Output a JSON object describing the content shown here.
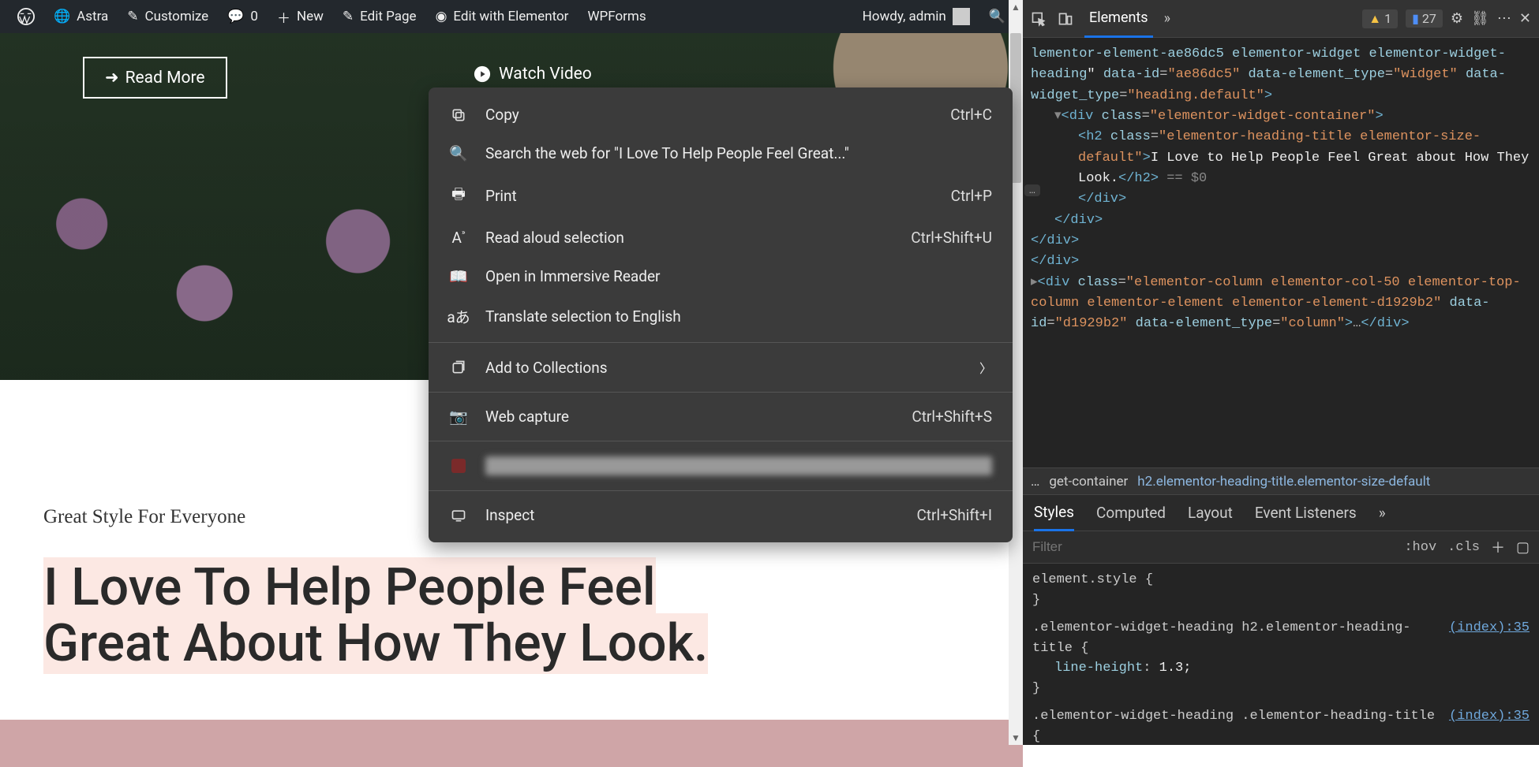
{
  "admin_bar": {
    "site_name": "Astra",
    "customize": "Customize",
    "comments_count": "0",
    "new": "New",
    "edit_page": "Edit Page",
    "edit_elementor": "Edit with Elementor",
    "wpforms": "WPForms",
    "howdy": "Howdy, admin"
  },
  "hero": {
    "read_more": "Read More",
    "watch_video": "Watch Video"
  },
  "content": {
    "subheading": "Great Style For Everyone",
    "heading_line1": "I Love To Help People Feel",
    "heading_line2": "Great About How They Look."
  },
  "context_menu": {
    "copy": "Copy",
    "copy_shortcut": "Ctrl+C",
    "search": "Search the web for \"I Love To Help People Feel Great...\"",
    "print": "Print",
    "print_shortcut": "Ctrl+P",
    "read_aloud": "Read aloud selection",
    "read_aloud_shortcut": "Ctrl+Shift+U",
    "immersive": "Open in Immersive Reader",
    "translate": "Translate selection to English",
    "collections": "Add to Collections",
    "web_capture": "Web capture",
    "web_capture_shortcut": "Ctrl+Shift+S",
    "blurred_item": "████████████",
    "inspect": "Inspect",
    "inspect_shortcut": "Ctrl+Shift+I"
  },
  "devtools": {
    "tab_elements": "Elements",
    "warn_count": "1",
    "info_count": "27",
    "dom": {
      "l1": "lementor-element-ae86dc5 elementor-widget elementor-widget-heading\" data-id=\"ae86dc5\" data-element_type=\"widget\" data-widget_type=\"heading.default\">",
      "l2_open": "<div class=\"elementor-widget-container\">",
      "l3_open": "<h2 class=\"elementor-heading-title elementor-size-default\">",
      "l3_text": "I Love to Help People Feel Great about How They Look.",
      "l3_close": "</h2>",
      "l3_eq": " == $0",
      "l4": "</div>",
      "l5": "</div>",
      "l6": "</div>",
      "l7": "</div>",
      "l8": "<div class=\"elementor-column elementor-col-50 elementor-top-column elementor-element elementor-element-d1929b2\" data-id=\"d1929b2\" data-element_type=\"column\">…</div>"
    },
    "breadcrumb": {
      "dots": "…",
      "a": "get-container",
      "b": "h2.elementor-heading-title.elementor-size-default"
    },
    "styles_tabs": {
      "styles": "Styles",
      "computed": "Computed",
      "layout": "Layout",
      "events": "Event Listeners"
    },
    "filter_placeholder": "Filter",
    "hov": ":hov",
    "cls": ".cls",
    "styles_body": {
      "el_style": "element.style {",
      "close": "}",
      "rule1_sel": ".elementor-widget-heading h2.elementor-heading-title {",
      "rule1_link": "(index):35",
      "rule1_prop": "line-height",
      "rule1_val": "1.3;",
      "rule2_sel": ".elementor-widget-heading .elementor-heading-title {",
      "rule2_link": "(index):35"
    }
  }
}
